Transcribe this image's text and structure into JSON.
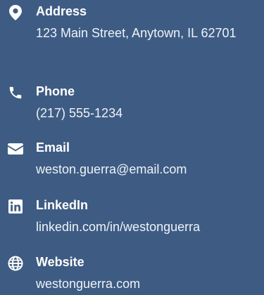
{
  "contact": {
    "address": {
      "label": "Address",
      "value": "123 Main Street, Anytown, IL 62701",
      "icon": "location-pin-icon"
    },
    "phone": {
      "label": "Phone",
      "value": "(217) 555-1234",
      "icon": "phone-icon"
    },
    "email": {
      "label": "Email",
      "value": "weston.guerra@email.com",
      "icon": "envelope-icon"
    },
    "linkedin": {
      "label": "LinkedIn",
      "value": "linkedin.com/in/westonguerra",
      "icon": "linkedin-icon"
    },
    "website": {
      "label": "Website",
      "value": "westonguerra.com",
      "icon": "globe-icon"
    }
  },
  "colors": {
    "background": "#3e5c83",
    "text": "#ffffff"
  }
}
